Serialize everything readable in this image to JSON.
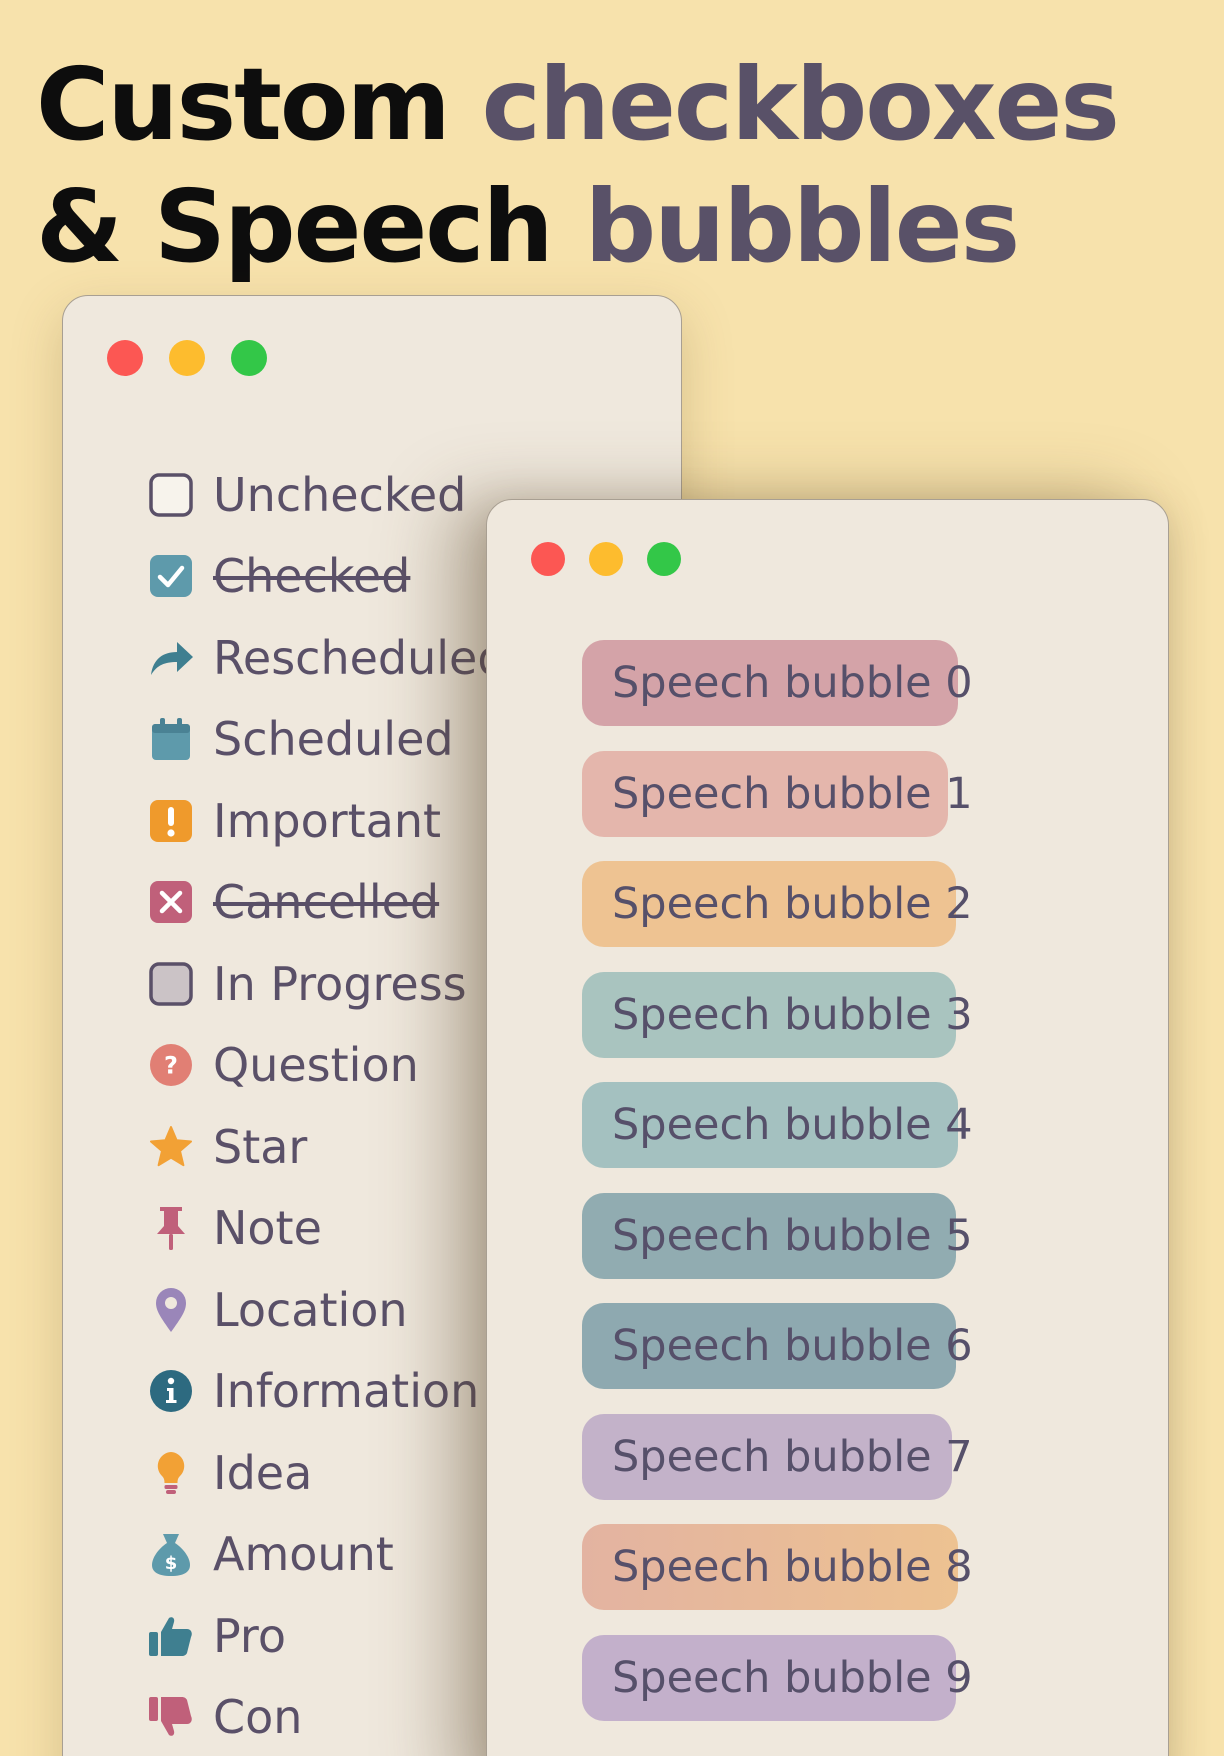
{
  "headline": {
    "line1_word1": "Custom",
    "line1_word2": "checkboxes",
    "line2_word1": "& Speech",
    "line2_word2": "bubbles"
  },
  "colors": {
    "background": "#f7e2ac",
    "window_bg": "#efe8dd",
    "text": "#5a5068",
    "headline_dark": "#0d0d0d",
    "headline_accent": "#595168"
  },
  "checkbox_window": {
    "items": [
      {
        "label": "Unchecked",
        "icon": "empty-checkbox-icon",
        "struck": false
      },
      {
        "label": "Checked",
        "icon": "checked-checkbox-icon",
        "struck": true
      },
      {
        "label": "Rescheduled",
        "icon": "share-arrow-icon",
        "struck": false
      },
      {
        "label": "Scheduled",
        "icon": "calendar-icon",
        "struck": false
      },
      {
        "label": "Important",
        "icon": "exclamation-icon",
        "struck": false
      },
      {
        "label": "Cancelled",
        "icon": "x-box-icon",
        "struck": true
      },
      {
        "label": "In Progress",
        "icon": "in-progress-checkbox-icon",
        "struck": false
      },
      {
        "label": "Question",
        "icon": "question-circle-icon",
        "struck": false
      },
      {
        "label": "Star",
        "icon": "star-icon",
        "struck": false
      },
      {
        "label": "Note",
        "icon": "pin-icon",
        "struck": false
      },
      {
        "label": "Location",
        "icon": "location-pin-icon",
        "struck": false
      },
      {
        "label": "Information",
        "icon": "info-circle-icon",
        "struck": false
      },
      {
        "label": "Idea",
        "icon": "lightbulb-icon",
        "struck": false
      },
      {
        "label": "Amount",
        "icon": "money-bag-icon",
        "struck": false
      },
      {
        "label": "Pro",
        "icon": "thumbs-up-icon",
        "struck": false
      },
      {
        "label": "Con",
        "icon": "thumbs-down-icon",
        "struck": false
      }
    ]
  },
  "bubble_window": {
    "bubbles": [
      {
        "label": "Speech bubble 0",
        "color": "#d4a3a8",
        "width": 0
      },
      {
        "label": "Speech bubble 1",
        "color": "#e4b6ac"
      },
      {
        "label": "Speech bubble 2",
        "color": "#eec392"
      },
      {
        "label": "Speech bubble 3",
        "color": "#a9c4bf"
      },
      {
        "label": "Speech bubble 4",
        "color": "#a4c1c0"
      },
      {
        "label": "Speech bubble 5",
        "color": "#91acb1"
      },
      {
        "label": "Speech bubble 6",
        "color": "#8ea9b0"
      },
      {
        "label": "Speech bubble 7",
        "color": "#c3b2c9"
      },
      {
        "label": "Speech bubble 8",
        "color": "#e3b3a1",
        "color2": "#edc291"
      },
      {
        "label": "Speech bubble 9",
        "color": "#c3b0cb"
      }
    ]
  }
}
